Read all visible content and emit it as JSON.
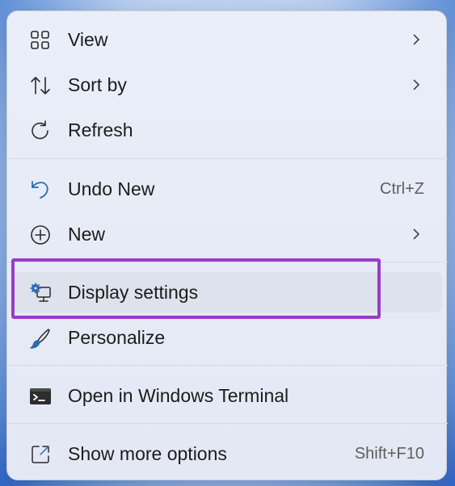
{
  "menu": {
    "items": [
      {
        "label": "View",
        "icon": "grid-icon",
        "submenu": true
      },
      {
        "label": "Sort by",
        "icon": "sort-arrows-icon",
        "submenu": true
      },
      {
        "label": "Refresh",
        "icon": "refresh-icon"
      },
      {
        "label": "Undo New",
        "icon": "undo-icon",
        "shortcut": "Ctrl+Z"
      },
      {
        "label": "New",
        "icon": "plus-circle-icon",
        "submenu": true
      },
      {
        "label": "Display settings",
        "icon": "display-settings-icon",
        "hovered": true
      },
      {
        "label": "Personalize",
        "icon": "paintbrush-icon"
      },
      {
        "label": "Open in Windows Terminal",
        "icon": "terminal-icon"
      },
      {
        "label": "Show more options",
        "icon": "share-icon",
        "shortcut": "Shift+F10"
      }
    ]
  },
  "colors": {
    "highlight_border": "#9b3cc9",
    "accent": "#2b6cb0"
  }
}
